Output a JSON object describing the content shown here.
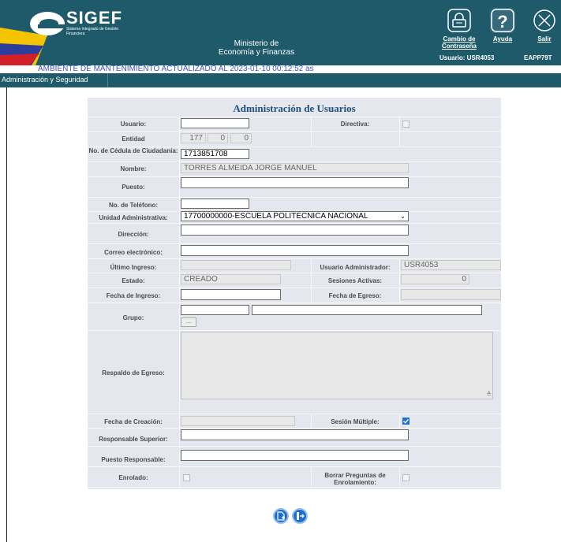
{
  "header": {
    "logo_text": "SIGEF",
    "logo_subtitle": "Sistema Integrado de Gestión Financiera",
    "ministry_line1": "Ministerio de",
    "ministry_line2": "Economía y Finanzas",
    "change_password_label": "Cambio de Contraseña",
    "help_label": "Ayuda",
    "logout_label": "Salir",
    "user_info": "Usuario: USR4053",
    "env_code": "EAPP79T"
  },
  "environment_banner": "AMBIENTE DE MANTENIMIENTO ACTUALIZADO AL 2023-01-10 00:12:52 as",
  "menu": {
    "admin_label": "Administración y Seguridad"
  },
  "form": {
    "title": "Administración de Usuarios",
    "labels": {
      "usuario": "Usuario:",
      "directiva": "Directiva:",
      "entidad": "Entidad",
      "cedula": "No. de Cédula de Ciudadanía:",
      "nombre": "Nombre:",
      "puesto": "Puesto:",
      "telefono": "No. de Teléfono:",
      "unidad": "Unidad Administrativa:",
      "direccion": "Dirección:",
      "correo": "Correo electrónico:",
      "ultimo_ingreso": "Último Ingreso:",
      "usuario_admin": "Usuario Administrador:",
      "estado": "Estado:",
      "sesiones": "Sesiones Activas:",
      "fecha_ingreso": "Fecha de Ingreso:",
      "fecha_egreso": "Fecha de Egreso:",
      "grupo": "Grupo:",
      "respaldo": "Respaldo de Egreso:",
      "fecha_creacion": "Fecha de Creación:",
      "sesion_multiple": "Sesión Múltiple:",
      "responsable_superior": "Responsable Superior:",
      "puesto_responsable": "Puesto Responsable:",
      "enrolado": "Enrolado:",
      "borrar_preguntas": "Borrar Preguntas de Enrolamiento:"
    },
    "values": {
      "usuario": "",
      "entidad_1": "177",
      "entidad_2": "0",
      "entidad_3": "0",
      "cedula": "1713851708",
      "nombre": "TORRES ALMEIDA JORGE MANUEL",
      "puesto": "",
      "telefono": "",
      "unidad": "17700000000-ESCUELA POLITECNICA NACIONAL",
      "direccion": "",
      "correo": "",
      "ultimo_ingreso": "",
      "usuario_admin": "USR4053",
      "estado": "CREADO",
      "sesiones": "0",
      "fecha_ingreso": "",
      "fecha_egreso": "",
      "grupo_code": "",
      "grupo_name": "",
      "grupo_lookup": "...",
      "respaldo": "",
      "fecha_creacion": "",
      "responsable_superior": "",
      "puesto_responsable": ""
    },
    "checkboxes": {
      "directiva": false,
      "sesion_multiple": true,
      "enrolado": false,
      "borrar_preguntas": false
    }
  },
  "actions": {
    "new_icon": "new-document-icon",
    "exit_icon": "exit-icon"
  },
  "colors": {
    "header_bg": "#1f5a6b",
    "title_color": "#1f4e79",
    "banner_text": "#3b56c9",
    "accent_blue": "#1e6fd0"
  }
}
